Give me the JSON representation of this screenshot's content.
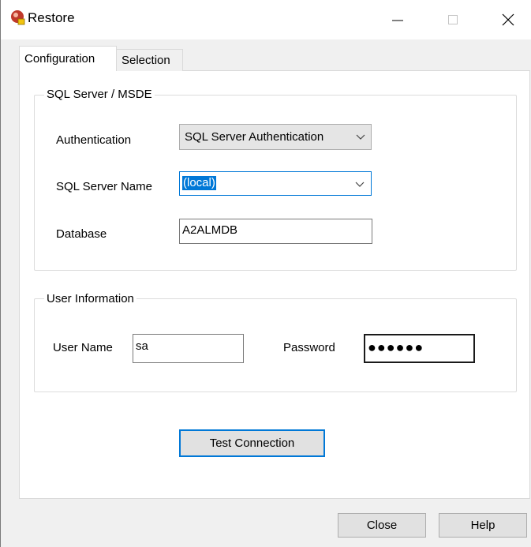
{
  "window": {
    "title": "Restore",
    "icon": "restore-app-icon"
  },
  "tabs": [
    {
      "label": "Configuration",
      "active": true
    },
    {
      "label": "Selection",
      "active": false
    }
  ],
  "sql_group": {
    "legend": "SQL Server / MSDE",
    "authentication_label": "Authentication",
    "authentication_value": "SQL Server Authentication",
    "server_name_label": "SQL Server Name",
    "server_name_value": "(local)",
    "database_label": "Database",
    "database_value": "A2ALMDB"
  },
  "user_group": {
    "legend": "User Information",
    "username_label": "User Name",
    "username_value": "sa",
    "password_label": "Password",
    "password_mask": "●●●●●●"
  },
  "buttons": {
    "test_connection": "Test Connection",
    "close": "Close",
    "help": "Help"
  },
  "colors": {
    "accent": "#0078d7",
    "button_face": "#e1e1e1",
    "dialog_bg": "#f0f0f0"
  }
}
